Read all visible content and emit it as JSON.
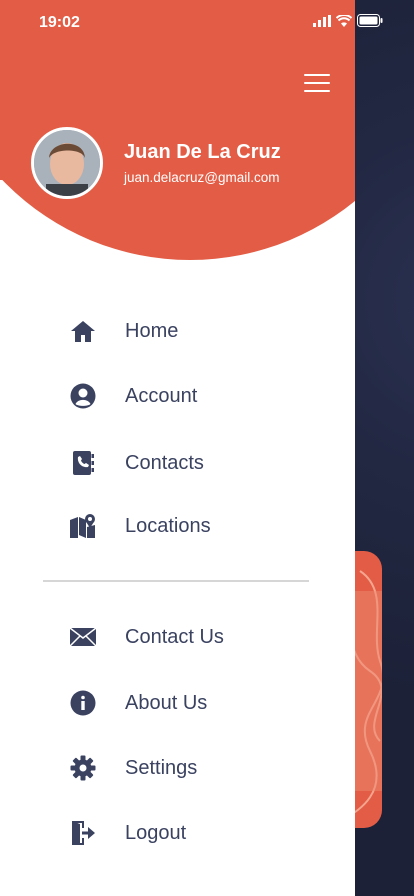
{
  "status_bar": {
    "time": "19:02"
  },
  "user": {
    "name": "Juan De La Cruz",
    "email": "juan.delacruz@gmail.com"
  },
  "menu": {
    "primary": [
      {
        "label": "Home",
        "icon": "home-icon"
      },
      {
        "label": "Account",
        "icon": "account-icon"
      },
      {
        "label": "Contacts",
        "icon": "contacts-book-icon"
      },
      {
        "label": "Locations",
        "icon": "map-pin-icon"
      }
    ],
    "secondary": [
      {
        "label": "Contact Us",
        "icon": "envelope-icon"
      },
      {
        "label": "About Us",
        "icon": "info-icon"
      },
      {
        "label": "Settings",
        "icon": "gear-icon"
      },
      {
        "label": "Logout",
        "icon": "logout-icon"
      }
    ]
  },
  "colors": {
    "accent": "#e35c45",
    "icon": "#3a4260",
    "background": "#1f2540"
  }
}
